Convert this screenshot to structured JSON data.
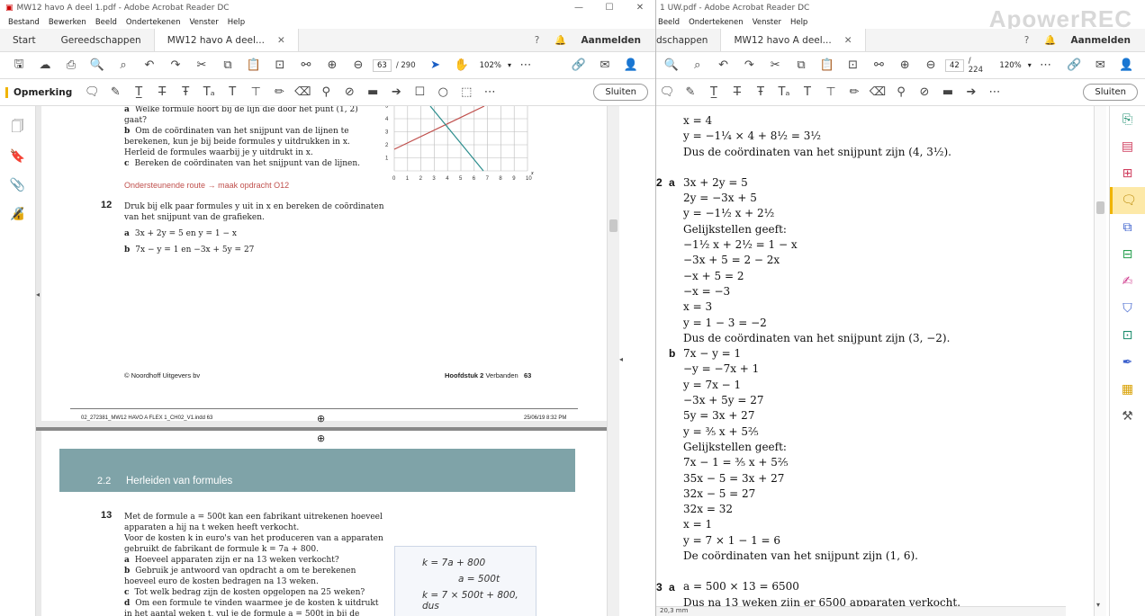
{
  "left": {
    "title": "MW12 havo A deel 1.pdf - Adobe Acrobat Reader DC",
    "menu": [
      "Bestand",
      "Bewerken",
      "Beeld",
      "Ondertekenen",
      "Venster",
      "Help"
    ],
    "tabs": {
      "start": "Start",
      "tools": "Gereedschappen",
      "doc": "MW12 havo A deel..."
    },
    "signin": "Aanmelden",
    "page_current": "63",
    "page_total": "/ 290",
    "zoom": "102%",
    "comment_label": "Opmerking",
    "close_label": "Sluiten",
    "content": {
      "q11_a": "Welke formule hoort bij de lijn die door het punt (1, 2) gaat?",
      "q11_b": "Om de coördinaten van het snijpunt van de lijnen te berekenen, kun je bij beide formules y uitdrukken in x. Herleid de formules waarbij je y uitdrukt in x.",
      "q11_c": "Bereken de coördinaten van het snijpunt van de lijnen.",
      "route": "Ondersteunende route → maak opdracht O12",
      "q12_num": "12",
      "q12_text": "Druk bij elk paar formules y uit in x en bereken de coördinaten van het snijpunt van de grafieken.",
      "q12_a": "3x + 2y = 5 en y = 1 − x",
      "q12_b": "7x − y = 1 en −3x + 5y = 27",
      "footer_left": "© Noordhoff Uitgevers bv",
      "footer_chapter": "Hoofdstuk 2",
      "footer_chapter_name": "Verbanden",
      "footer_page": "63",
      "slug_file": "02_272381_MW12 HAVO A FLEX 1_CH02_V1.indd   63",
      "slug_date": "25/06/19   8:32 PM",
      "section_num": "2.2",
      "section_title": "Herleiden van formules",
      "q13_num": "13",
      "q13_text": "Met de formule a = 500t kan een fabrikant uitrekenen hoeveel apparaten a hij na t weken heeft verkocht.",
      "q13_text2": "Voor de kosten k in euro's van het produceren van a apparaten gebruikt de fabrikant de formule k = 7a + 800.",
      "q13_a": "Hoeveel apparaten zijn er na 13 weken verkocht?",
      "q13_b": "Gebruik je antwoord van opdracht a om te berekenen hoeveel euro de kosten bedragen na 13 weken.",
      "q13_c": "Tot welk bedrag zijn de kosten opgelopen na 25 weken?",
      "q13_d": "Om een formule te vinden waarmee je de kosten k uitdrukt in het aantal weken t, vul je de formule a = 500t in bij de",
      "note_line1": "k = 7a + 800",
      "note_line2": "a = 500t",
      "note_line3": "k = 7 × 500t + 800, dus",
      "graph_y_ticks": [
        "1",
        "2",
        "3",
        "4",
        "5"
      ],
      "graph_x_ticks": [
        "0",
        "1",
        "2",
        "3",
        "4",
        "5",
        "6",
        "7",
        "8",
        "9",
        "10"
      ],
      "graph_x_label": "x"
    }
  },
  "right": {
    "title": "1 UW.pdf - Adobe Acrobat Reader DC",
    "menu": [
      "Beeld",
      "Ondertekenen",
      "Venster",
      "Help"
    ],
    "tabs": {
      "tools": "dschappen",
      "doc": "MW12 havo A deel..."
    },
    "signin": "Aanmelden",
    "page_current": "42",
    "page_total": "/ 224",
    "zoom": "120%",
    "close_label": "Sluiten",
    "status": "20,3 mm",
    "solutions": {
      "top1": "x = 4",
      "top2": "y = −1¼ × 4 + 8½ = 3½",
      "top3": "Dus de coördinaten van het snijpunt zijn (4, 3½).",
      "n2": "2",
      "a_lbl": "a",
      "a1": "3x + 2y = 5",
      "a2": "2y = −3x + 5",
      "a3": "y = −1½ x + 2½",
      "a4": "Gelijkstellen geeft:",
      "a5": "−1½ x + 2½ = 1 − x",
      "a6": "−3x + 5 = 2 − 2x",
      "a7": "−x + 5 = 2",
      "a8": "−x = −3",
      "a9": "x = 3",
      "a10": "y = 1 − 3 = −2",
      "a11": "Dus de coördinaten van het snijpunt zijn (3, −2).",
      "b_lbl": "b",
      "b1": "7x − y = 1",
      "b2": "−y = −7x + 1",
      "b3": "y = 7x − 1",
      "b4": "−3x + 5y = 27",
      "b5": "5y = 3x + 27",
      "b6": "y = ⅗ x + 5⅖",
      "b7": "Gelijkstellen geeft:",
      "b8": "7x − 1 = ⅗ x + 5⅖",
      "b9": "35x − 5 = 3x + 27",
      "b10": "32x − 5 = 27",
      "b11": "32x = 32",
      "b12": "x = 1",
      "b13": "y = 7 × 1 − 1 = 6",
      "b14": "De coördinaten van het snijpunt zijn (1, 6).",
      "n3": "3",
      "c_lbl": "a",
      "c1": "a = 500 × 13 = 6500",
      "c2": "Dus na 13 weken zijn er 6500 apparaten verkocht."
    }
  },
  "watermark": "ApowerREC"
}
